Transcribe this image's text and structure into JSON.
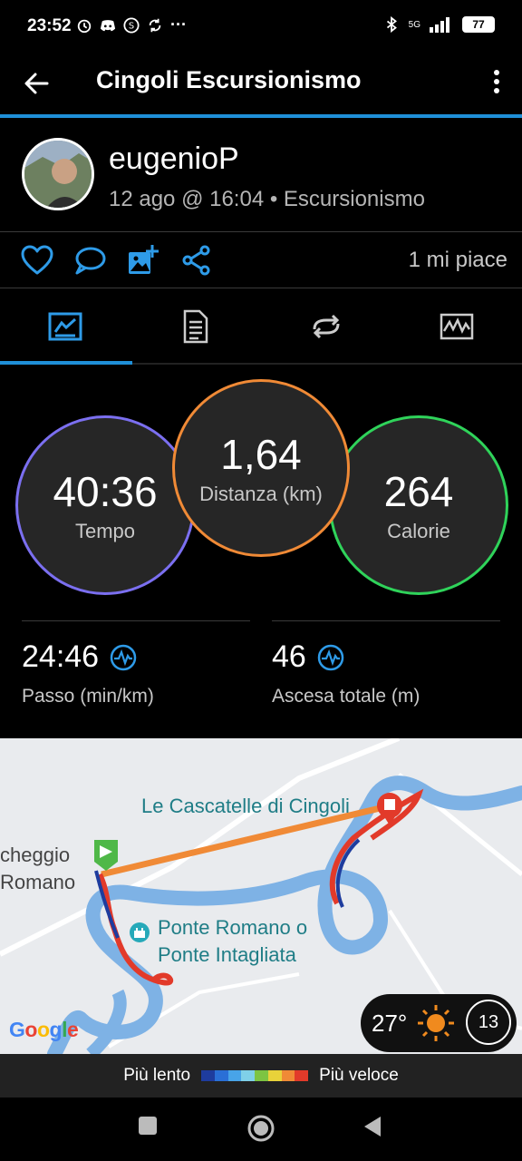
{
  "status_bar": {
    "time": "23:52",
    "signal": "5G",
    "battery": "77"
  },
  "app_bar": {
    "title": "Cingoli Escursionismo",
    "back_icon": "arrow-left-icon",
    "menu_icon": "more-vert-icon"
  },
  "user": {
    "name": "eugenioP",
    "meta": "12 ago @ 16:04 • Escursionismo"
  },
  "actions": {
    "likes": "1 mi piace",
    "icons": [
      "heart-icon",
      "comment-icon",
      "add-photo-icon",
      "share-icon"
    ]
  },
  "tabs": [
    "chart-icon",
    "document-icon",
    "repeat-icon",
    "activity-icon"
  ],
  "stats": {
    "time": {
      "value": "40:36",
      "label": "Tempo",
      "color": "#7b6ff0"
    },
    "distance": {
      "value": "1,64",
      "label": "Distanza (km)",
      "color": "#f08a36"
    },
    "calories": {
      "value": "264",
      "label": "Calorie",
      "color": "#2fd35a"
    },
    "pace": {
      "value": "24:46",
      "label": "Passo (min/km)"
    },
    "ascent": {
      "value": "46",
      "label": "Ascesa totale (m)"
    }
  },
  "map": {
    "poi_1": "Le Cascatelle di Cingoli",
    "poi_2_line1": "Ponte Romano o",
    "poi_2_line2": "Ponte Intagliata",
    "left_label_1": "cheggio",
    "left_label_2": "Romano",
    "attribution": "Google",
    "weather_temp": "27°",
    "uv_index": "13"
  },
  "legend": {
    "slow": "Più lento",
    "fast": "Più veloce",
    "colors": [
      "#1e3c9e",
      "#2a6fd6",
      "#48a4e8",
      "#7fd0e8",
      "#7dc442",
      "#e8d23a",
      "#f08a36",
      "#e23a2a"
    ]
  },
  "accent_color": "#1f8fd8"
}
